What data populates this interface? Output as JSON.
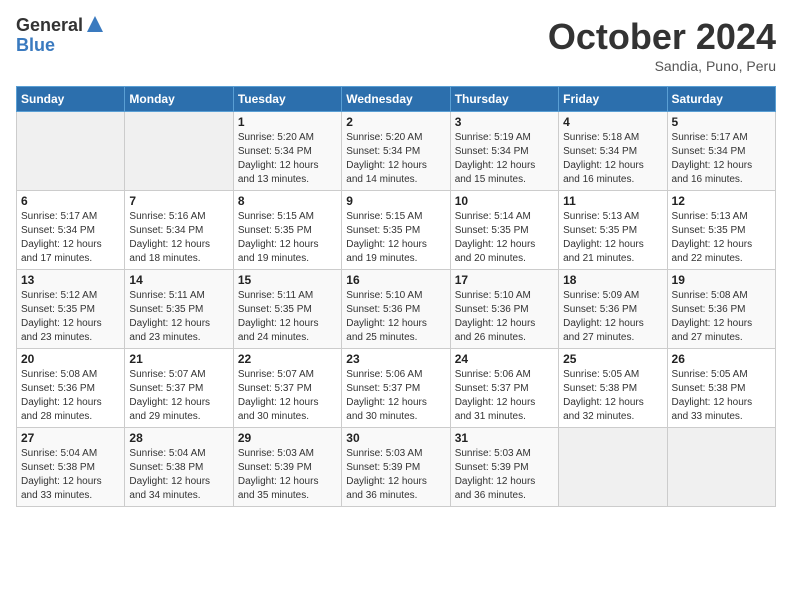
{
  "logo": {
    "general": "General",
    "blue": "Blue"
  },
  "header": {
    "month": "October 2024",
    "location": "Sandia, Puno, Peru"
  },
  "weekdays": [
    "Sunday",
    "Monday",
    "Tuesday",
    "Wednesday",
    "Thursday",
    "Friday",
    "Saturday"
  ],
  "weeks": [
    [
      {
        "day": "",
        "info": ""
      },
      {
        "day": "",
        "info": ""
      },
      {
        "day": "1",
        "info": "Sunrise: 5:20 AM\nSunset: 5:34 PM\nDaylight: 12 hours and 13 minutes."
      },
      {
        "day": "2",
        "info": "Sunrise: 5:20 AM\nSunset: 5:34 PM\nDaylight: 12 hours and 14 minutes."
      },
      {
        "day": "3",
        "info": "Sunrise: 5:19 AM\nSunset: 5:34 PM\nDaylight: 12 hours and 15 minutes."
      },
      {
        "day": "4",
        "info": "Sunrise: 5:18 AM\nSunset: 5:34 PM\nDaylight: 12 hours and 16 minutes."
      },
      {
        "day": "5",
        "info": "Sunrise: 5:17 AM\nSunset: 5:34 PM\nDaylight: 12 hours and 16 minutes."
      }
    ],
    [
      {
        "day": "6",
        "info": "Sunrise: 5:17 AM\nSunset: 5:34 PM\nDaylight: 12 hours and 17 minutes."
      },
      {
        "day": "7",
        "info": "Sunrise: 5:16 AM\nSunset: 5:34 PM\nDaylight: 12 hours and 18 minutes."
      },
      {
        "day": "8",
        "info": "Sunrise: 5:15 AM\nSunset: 5:35 PM\nDaylight: 12 hours and 19 minutes."
      },
      {
        "day": "9",
        "info": "Sunrise: 5:15 AM\nSunset: 5:35 PM\nDaylight: 12 hours and 19 minutes."
      },
      {
        "day": "10",
        "info": "Sunrise: 5:14 AM\nSunset: 5:35 PM\nDaylight: 12 hours and 20 minutes."
      },
      {
        "day": "11",
        "info": "Sunrise: 5:13 AM\nSunset: 5:35 PM\nDaylight: 12 hours and 21 minutes."
      },
      {
        "day": "12",
        "info": "Sunrise: 5:13 AM\nSunset: 5:35 PM\nDaylight: 12 hours and 22 minutes."
      }
    ],
    [
      {
        "day": "13",
        "info": "Sunrise: 5:12 AM\nSunset: 5:35 PM\nDaylight: 12 hours and 23 minutes."
      },
      {
        "day": "14",
        "info": "Sunrise: 5:11 AM\nSunset: 5:35 PM\nDaylight: 12 hours and 23 minutes."
      },
      {
        "day": "15",
        "info": "Sunrise: 5:11 AM\nSunset: 5:35 PM\nDaylight: 12 hours and 24 minutes."
      },
      {
        "day": "16",
        "info": "Sunrise: 5:10 AM\nSunset: 5:36 PM\nDaylight: 12 hours and 25 minutes."
      },
      {
        "day": "17",
        "info": "Sunrise: 5:10 AM\nSunset: 5:36 PM\nDaylight: 12 hours and 26 minutes."
      },
      {
        "day": "18",
        "info": "Sunrise: 5:09 AM\nSunset: 5:36 PM\nDaylight: 12 hours and 27 minutes."
      },
      {
        "day": "19",
        "info": "Sunrise: 5:08 AM\nSunset: 5:36 PM\nDaylight: 12 hours and 27 minutes."
      }
    ],
    [
      {
        "day": "20",
        "info": "Sunrise: 5:08 AM\nSunset: 5:36 PM\nDaylight: 12 hours and 28 minutes."
      },
      {
        "day": "21",
        "info": "Sunrise: 5:07 AM\nSunset: 5:37 PM\nDaylight: 12 hours and 29 minutes."
      },
      {
        "day": "22",
        "info": "Sunrise: 5:07 AM\nSunset: 5:37 PM\nDaylight: 12 hours and 30 minutes."
      },
      {
        "day": "23",
        "info": "Sunrise: 5:06 AM\nSunset: 5:37 PM\nDaylight: 12 hours and 30 minutes."
      },
      {
        "day": "24",
        "info": "Sunrise: 5:06 AM\nSunset: 5:37 PM\nDaylight: 12 hours and 31 minutes."
      },
      {
        "day": "25",
        "info": "Sunrise: 5:05 AM\nSunset: 5:38 PM\nDaylight: 12 hours and 32 minutes."
      },
      {
        "day": "26",
        "info": "Sunrise: 5:05 AM\nSunset: 5:38 PM\nDaylight: 12 hours and 33 minutes."
      }
    ],
    [
      {
        "day": "27",
        "info": "Sunrise: 5:04 AM\nSunset: 5:38 PM\nDaylight: 12 hours and 33 minutes."
      },
      {
        "day": "28",
        "info": "Sunrise: 5:04 AM\nSunset: 5:38 PM\nDaylight: 12 hours and 34 minutes."
      },
      {
        "day": "29",
        "info": "Sunrise: 5:03 AM\nSunset: 5:39 PM\nDaylight: 12 hours and 35 minutes."
      },
      {
        "day": "30",
        "info": "Sunrise: 5:03 AM\nSunset: 5:39 PM\nDaylight: 12 hours and 36 minutes."
      },
      {
        "day": "31",
        "info": "Sunrise: 5:03 AM\nSunset: 5:39 PM\nDaylight: 12 hours and 36 minutes."
      },
      {
        "day": "",
        "info": ""
      },
      {
        "day": "",
        "info": ""
      }
    ]
  ]
}
